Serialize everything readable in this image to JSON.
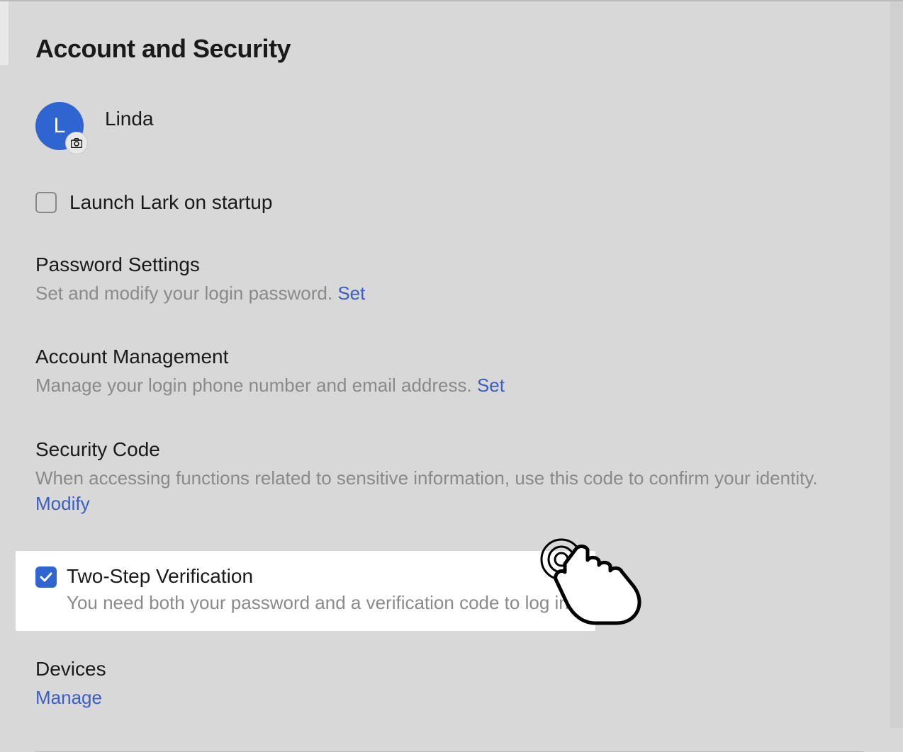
{
  "page": {
    "title": "Account and Security"
  },
  "profile": {
    "avatar_initial": "L",
    "name": "Linda"
  },
  "startup": {
    "label": "Launch Lark on startup",
    "checked": false
  },
  "password_settings": {
    "title": "Password Settings",
    "description": "Set and modify your login password. ",
    "action": "Set"
  },
  "account_management": {
    "title": "Account Management",
    "description": "Manage your login phone number and email address. ",
    "action": "Set"
  },
  "security_code": {
    "title": "Security Code",
    "description": "When accessing functions related to sensitive information, use this code to confirm your identity. ",
    "action": "Modify"
  },
  "two_step": {
    "title": "Two-Step Verification",
    "description": "You need both your password and a verification code to log in.",
    "checked": true
  },
  "devices": {
    "title": "Devices",
    "action": "Manage"
  }
}
